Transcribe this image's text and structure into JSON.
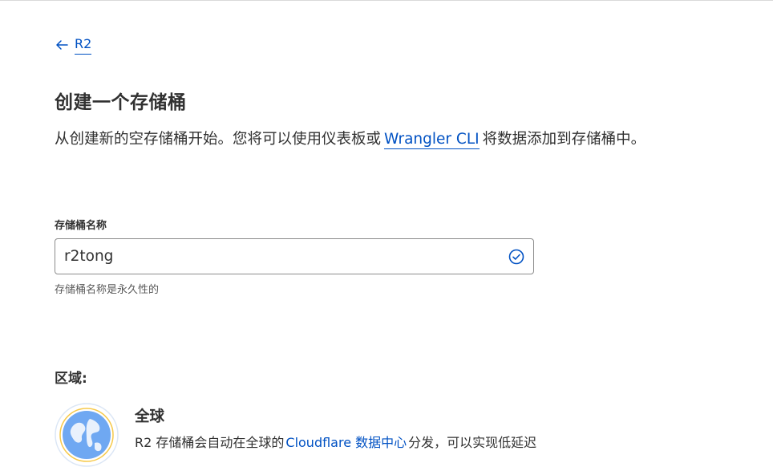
{
  "nav": {
    "back_label": "R2"
  },
  "page": {
    "title": "创建一个存储桶",
    "description_before": "从创建新的空存储桶开始。您将可以使用仪表板或",
    "description_link": "Wrangler CLI",
    "description_after": "将数据添加到存储桶中。"
  },
  "bucket_name": {
    "label": "存储桶名称",
    "value": "r2tong",
    "helper": "存储桶名称是永久性的",
    "status_icon": "check-circle-icon"
  },
  "region": {
    "label": "区域:",
    "option_icon": "globe-icon",
    "option_name": "全球",
    "option_desc_before": "R2 存储桶会自动在全球的",
    "option_desc_link": "Cloudflare 数据中心",
    "option_desc_after": "分发，可以实现低延迟"
  },
  "colors": {
    "link": "#0051c3",
    "text": "#313131",
    "success": "#0051c3"
  }
}
